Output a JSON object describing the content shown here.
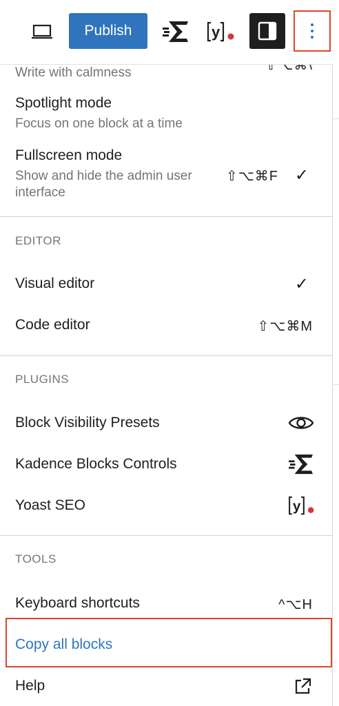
{
  "toolbar": {
    "publish_label": "Publish",
    "colors": {
      "publish_bg": "#3074bd",
      "highlight": "#e0432f"
    }
  },
  "menu": {
    "view": {
      "distraction_free_desc": "Write with calmness",
      "distraction_free_shortcut": "⇧⌥⌘\\",
      "spotlight_label": "Spotlight mode",
      "spotlight_desc": "Focus on one block at a time",
      "fullscreen_label": "Fullscreen mode",
      "fullscreen_desc": "Show and hide the admin user interface",
      "fullscreen_shortcut": "⇧⌥⌘F",
      "fullscreen_checked": "✓"
    },
    "editor": {
      "title": "EDITOR",
      "visual_label": "Visual editor",
      "visual_checked": "✓",
      "code_label": "Code editor",
      "code_shortcut": "⇧⌥⌘M"
    },
    "plugins": {
      "title": "PLUGINS",
      "block_visibility_label": "Block Visibility Presets",
      "kadence_label": "Kadence Blocks Controls",
      "yoast_label": "Yoast SEO"
    },
    "tools": {
      "title": "TOOLS",
      "keyboard_label": "Keyboard shortcuts",
      "keyboard_shortcut": "^⌥H",
      "copy_label": "Copy all blocks",
      "help_label": "Help"
    }
  }
}
